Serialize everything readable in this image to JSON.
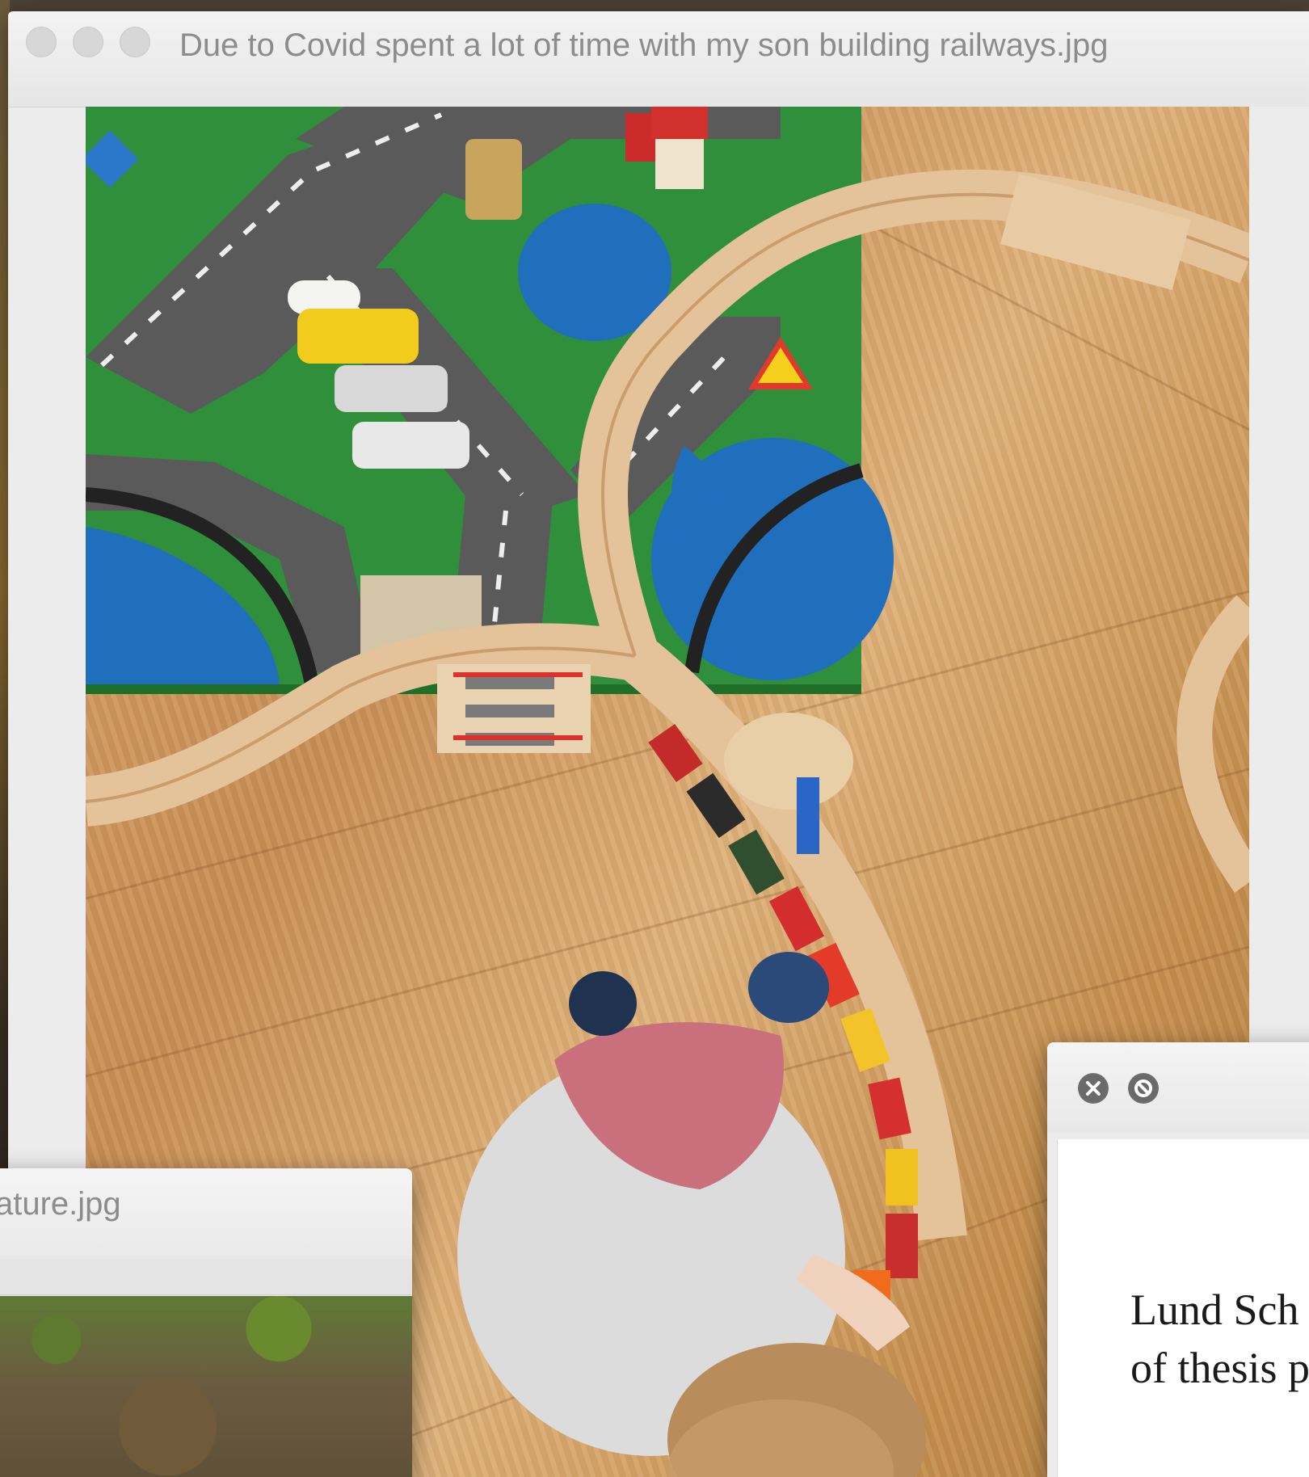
{
  "main_window": {
    "title": "Due to Covid spent a lot of time with my son building railways.jpg",
    "image_alt": "Overhead photo of a child playing with a wooden toy railway on a play mat and wooden floor"
  },
  "nature_window": {
    "title": "ature.jpg"
  },
  "pdf_window": {
    "line1": "Lund Sch",
    "line2": "of thesis p"
  },
  "icons": {
    "close": "close-circle-icon",
    "block": "block-circle-icon"
  }
}
